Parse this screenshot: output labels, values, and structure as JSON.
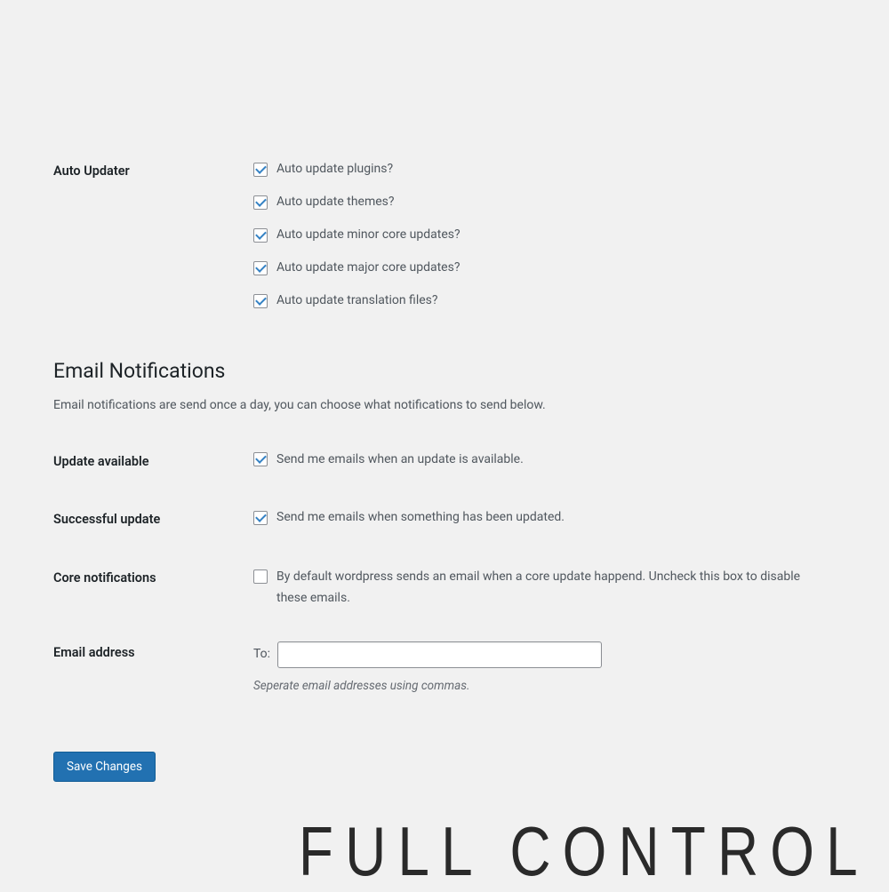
{
  "auto_updater": {
    "label": "Auto Updater",
    "options": [
      {
        "label": "Auto update plugins?",
        "checked": true
      },
      {
        "label": "Auto update themes?",
        "checked": true
      },
      {
        "label": "Auto update minor core updates?",
        "checked": true
      },
      {
        "label": "Auto update major core updates?",
        "checked": true
      },
      {
        "label": "Auto update translation files?",
        "checked": true
      }
    ]
  },
  "email_section": {
    "title": "Email Notifications",
    "description": "Email notifications are send once a day, you can choose what notifications to send below."
  },
  "update_available": {
    "label": "Update available",
    "option_label": "Send me emails when an update is available.",
    "checked": true
  },
  "successful_update": {
    "label": "Successful update",
    "option_label": "Send me emails when something has been updated.",
    "checked": true
  },
  "core_notifications": {
    "label": "Core notifications",
    "option_label": "By default wordpress sends an email when a core update happend. Uncheck this box to disable these emails.",
    "checked": false
  },
  "email_address": {
    "label": "Email address",
    "to_label": "To:",
    "value": "",
    "hint": "Seperate email addresses using commas."
  },
  "save_button": "Save Changes",
  "hero_text": "FULL CONTROL"
}
